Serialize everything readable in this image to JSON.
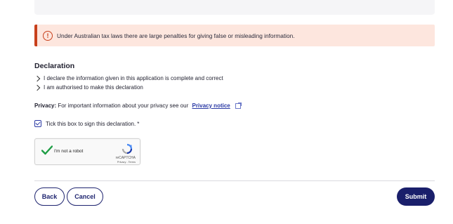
{
  "alert": {
    "text": "Under Australian tax laws there are large penalties for giving false or misleading information.",
    "icon": "exclamation-circle-icon"
  },
  "declaration": {
    "title": "Declaration",
    "items": [
      "I declare the information given in this application is complete and correct",
      "I am authorised to make this declaration"
    ]
  },
  "privacy": {
    "label": "Privacy:",
    "text": "For important information about your privacy see our",
    "link": "Privacy notice"
  },
  "sign": {
    "label": "Tick this box to sign this declaration.",
    "required": "*",
    "checked": true
  },
  "recaptcha": {
    "label": "I'm not a robot",
    "brand": "reCAPTCHA",
    "terms": "Privacy - Terms"
  },
  "actions": {
    "back": "Back",
    "cancel": "Cancel",
    "submit": "Submit"
  },
  "colors": {
    "accent": "#1a1f6b",
    "alert_border": "#c8401c",
    "alert_bg": "#fde6de",
    "link": "#2b3aa5"
  }
}
